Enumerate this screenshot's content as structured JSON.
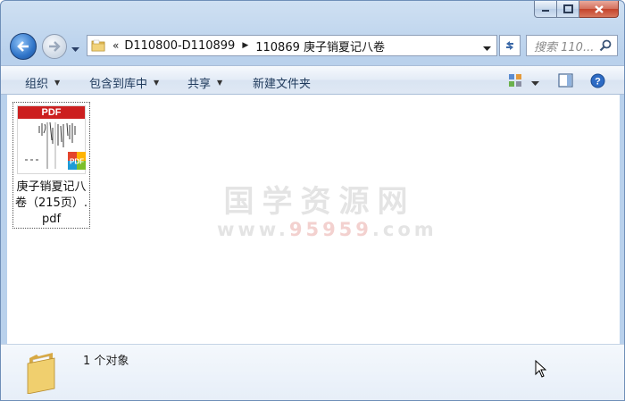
{
  "address": {
    "overflow": "«",
    "crumbs": [
      "D110800-D110899",
      "110869 庚子销夏记八卷"
    ]
  },
  "search": {
    "placeholder": "搜索 110..."
  },
  "toolbar": {
    "organize": "组织",
    "include_in_library": "包含到库中",
    "share": "共享",
    "new_folder": "新建文件夹"
  },
  "files": [
    {
      "name": "庚子销夏记八卷（215页）.pdf",
      "thumb_label": "PDF",
      "badge_label": "PDF"
    }
  ],
  "watermark": {
    "main": "国学资源网",
    "url_a": "www.",
    "url_b": "95959",
    "url_c": ".com"
  },
  "status": {
    "count_text": "1 个对象"
  },
  "colors": {
    "pdf_red": "#cc1f1f",
    "accent_blue": "#2f74c8"
  }
}
